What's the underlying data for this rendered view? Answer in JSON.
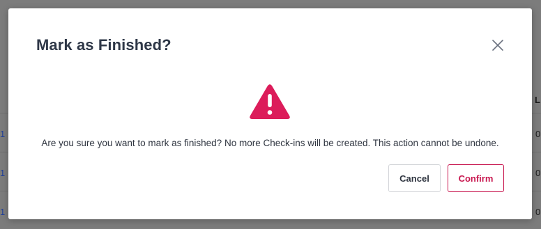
{
  "background": {
    "header_text": "L",
    "rows": [
      {
        "link": "1",
        "value": "0"
      },
      {
        "link": "1",
        "value": "0"
      },
      {
        "link": "1",
        "value": "0"
      }
    ]
  },
  "modal": {
    "title": "Mark as Finished?",
    "close_icon": "close-icon",
    "warning_icon": "warning-triangle-icon",
    "message": "Are you sure you want to mark as finished? No more Check-ins will be created. This action cannot be undone.",
    "cancel_label": "Cancel",
    "confirm_label": "Confirm"
  },
  "colors": {
    "accent": "#dc1c5a",
    "title": "#2e3747",
    "text": "#2f3540",
    "confirm_border": "#c8174f"
  }
}
